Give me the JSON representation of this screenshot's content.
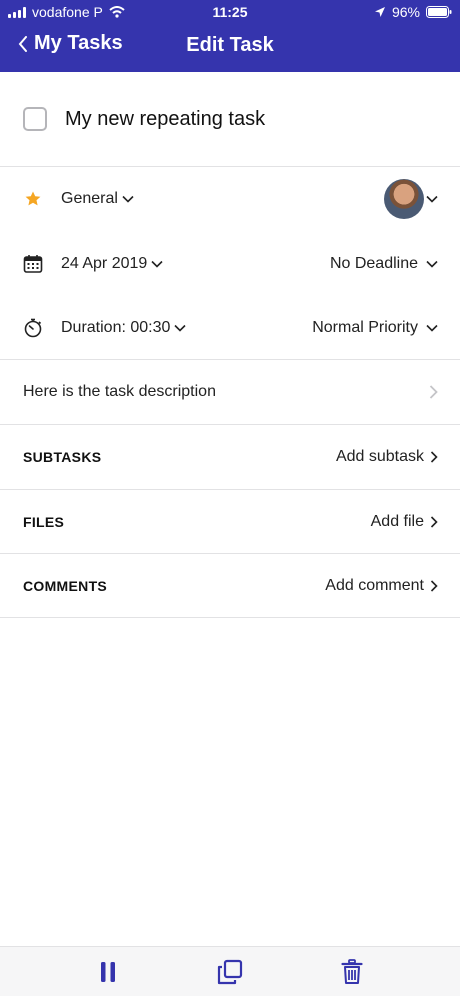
{
  "status_bar": {
    "carrier": "vodafone P",
    "time": "11:25",
    "battery": "96%"
  },
  "nav": {
    "back_label": "My Tasks",
    "title": "Edit Task"
  },
  "task": {
    "title": "My new repeating task",
    "checked": false
  },
  "details": {
    "list": "General",
    "date": "24 Apr 2019",
    "deadline": "No Deadline",
    "duration": "Duration: 00:30",
    "priority": "Normal Priority",
    "description": "Here is the task description"
  },
  "sections": {
    "subtasks": {
      "label": "SUBTASKS",
      "action": "Add subtask"
    },
    "files": {
      "label": "FILES",
      "action": "Add file"
    },
    "comments": {
      "label": "COMMENTS",
      "action": "Add comment"
    }
  },
  "toolbar": {
    "icons": [
      "pause-icon",
      "duplicate-icon",
      "trash-icon"
    ]
  },
  "colors": {
    "header": "#3534ad",
    "accent": "#3534ad",
    "star": "#f5a623"
  }
}
